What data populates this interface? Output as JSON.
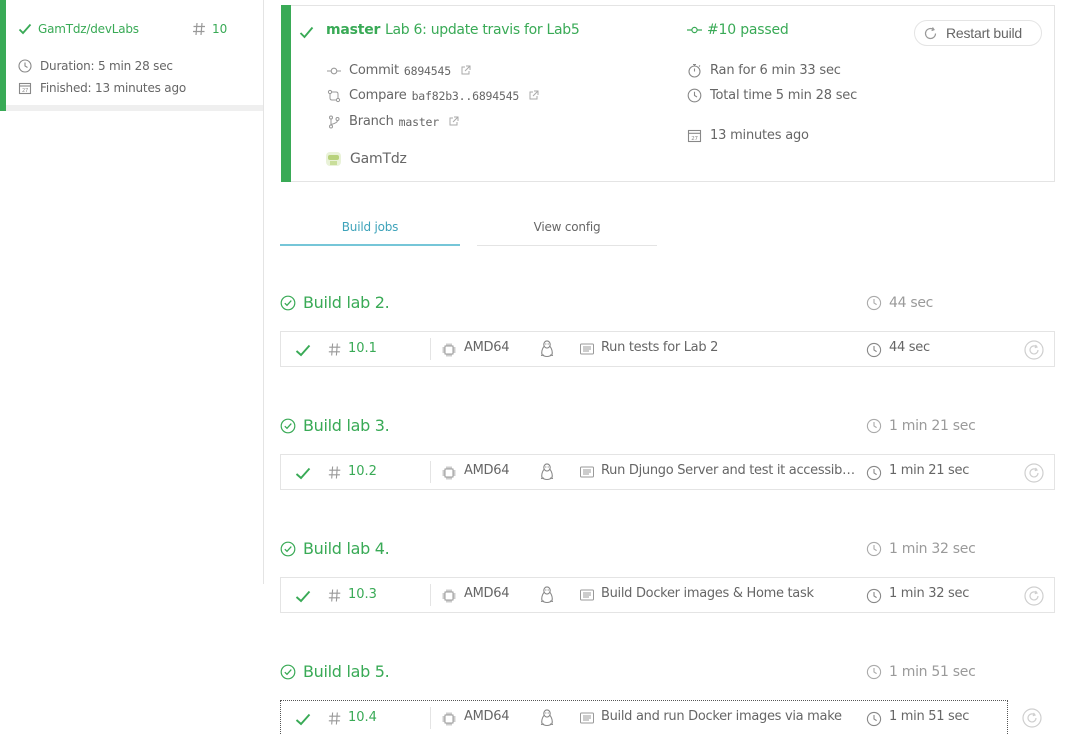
{
  "sidebar": {
    "repo": "GamTdz/devLabs",
    "build_number": "10",
    "duration": "Duration: 5 min 28 sec",
    "finished": "Finished: 13 minutes ago"
  },
  "build": {
    "branch": "master",
    "commit_message": "Lab 6: update travis for Lab5",
    "commit_label": "Commit",
    "commit_sha": "6894545",
    "compare_label": "Compare",
    "compare_range": "baf82b3..6894545",
    "branch_label": "Branch",
    "branch_name": "master",
    "author": "GamTdz",
    "status": "#10 passed",
    "ran_for": "Ran for 6 min 33 sec",
    "total_time": "Total time 5 min 28 sec",
    "finished_ago": "13 minutes ago",
    "restart_label": "Restart build"
  },
  "tabs": {
    "build_jobs": "Build jobs",
    "view_config": "View config"
  },
  "stages": [
    {
      "title": "Build lab 2.",
      "duration": "44 sec",
      "job": {
        "number": "10.1",
        "arch": "AMD64",
        "name": "Run tests for Lab 2",
        "duration": "44 sec"
      }
    },
    {
      "title": "Build lab 3.",
      "duration": "1 min 21 sec",
      "job": {
        "number": "10.2",
        "arch": "AMD64",
        "name": "Run Djungo Server and test it accessibility",
        "duration": "1 min 21 sec"
      }
    },
    {
      "title": "Build lab 4.",
      "duration": "1 min 32 sec",
      "job": {
        "number": "10.3",
        "arch": "AMD64",
        "name": "Build Docker images & Home task",
        "duration": "1 min 32 sec"
      }
    },
    {
      "title": "Build lab 5.",
      "duration": "1 min 51 sec",
      "job": {
        "number": "10.4",
        "arch": "AMD64",
        "name": "Build and run Docker images via make",
        "duration": "1 min 51 sec"
      }
    }
  ],
  "colors": {
    "passed_green": "#39aa56",
    "tab_active": "#3ea3ba",
    "border": "#e4e4e4",
    "text": "#666666",
    "muted": "#9a9a9a"
  },
  "icons": {
    "passed": "check-icon",
    "build_number": "hash-icon",
    "clock": "clock-icon",
    "calendar": "calendar-icon",
    "commit": "commit-icon",
    "compare": "compare-icon",
    "branch": "branch-icon",
    "external": "external-link-icon",
    "stopwatch": "stopwatch-icon",
    "restart": "restart-icon",
    "arch": "cpu-chip-icon",
    "os": "linux-penguin-icon",
    "job_name": "document-icon",
    "stage_passed": "circle-check-icon"
  }
}
